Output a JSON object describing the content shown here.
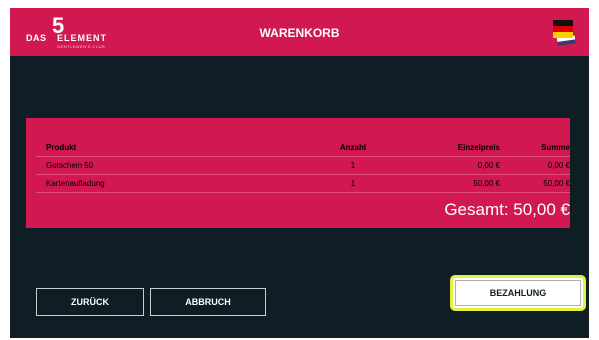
{
  "header": {
    "logo": {
      "number": "5",
      "word1": "DAS",
      "word2": "ELEMENT",
      "tagline": "GENTLEMEN'S CLUB"
    },
    "title": "WARENKORB",
    "language_flag": "german-flag"
  },
  "cart": {
    "columns": [
      "Produkt",
      "Anzahl",
      "Einzelpreis",
      "Summe"
    ],
    "rows": [
      {
        "product": "Gutschein 50",
        "qty": "1",
        "unit_price": "0,00 €",
        "sum": "0,00 €"
      },
      {
        "product": "Kartenaufladung",
        "qty": "1",
        "unit_price": "50,00 €",
        "sum": "50,00 €"
      }
    ],
    "total": "Gesamt: 50,00 €"
  },
  "buttons": {
    "back": "ZURÜCK",
    "cancel": "ABBRUCH",
    "pay": "BEZAHLUNG"
  },
  "colors": {
    "brand": "#d11850",
    "background": "#0f1d24",
    "focus": "#e4ef3f"
  }
}
